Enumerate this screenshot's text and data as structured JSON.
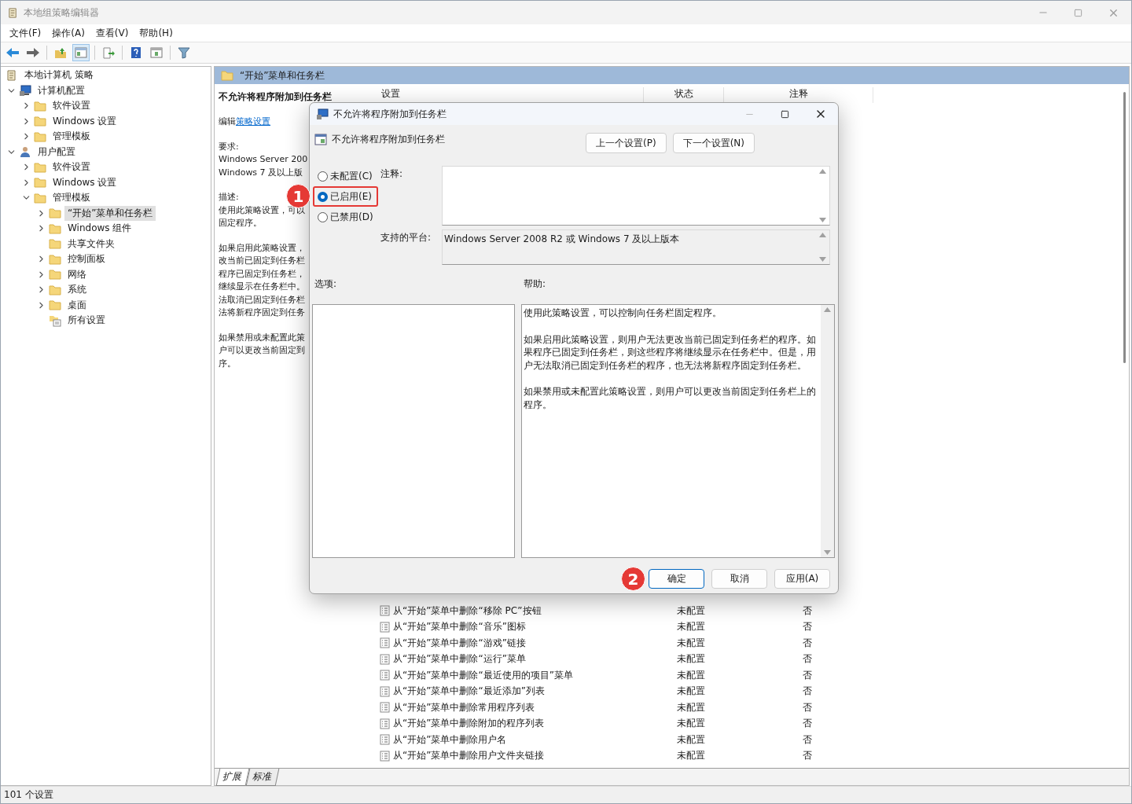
{
  "window": {
    "title": "本地组策略编辑器"
  },
  "menu": [
    "文件(F)",
    "操作(A)",
    "查看(V)",
    "帮助(H)"
  ],
  "toolbar": [
    {
      "kind": "back",
      "pressed": false
    },
    {
      "kind": "forward",
      "pressed": false
    },
    {
      "kind": "up",
      "pressed": false
    },
    {
      "kind": "tree",
      "pressed": true
    },
    {
      "kind": "export",
      "pressed": false
    },
    {
      "kind": "help",
      "pressed": false
    },
    {
      "kind": "view",
      "pressed": false
    },
    {
      "kind": "filter",
      "pressed": false
    }
  ],
  "tree": {
    "label": "本地计算机 策略",
    "kind": "policy",
    "selected": false,
    "children": [
      {
        "label": "计算机配置",
        "kind": "computer",
        "expanded": true,
        "selected": false,
        "children": [
          {
            "label": "软件设置",
            "kind": "folder",
            "expanded": false,
            "selected": false
          },
          {
            "label": "Windows 设置",
            "kind": "folder",
            "expanded": false,
            "selected": false
          },
          {
            "label": "管理模板",
            "kind": "folder",
            "expanded": false,
            "selected": false
          }
        ]
      },
      {
        "label": "用户配置",
        "kind": "user",
        "expanded": true,
        "selected": false,
        "children": [
          {
            "label": "软件设置",
            "kind": "folder",
            "expanded": false,
            "selected": false
          },
          {
            "label": "Windows 设置",
            "kind": "folder",
            "expanded": false,
            "selected": false
          },
          {
            "label": "管理模板",
            "kind": "folder",
            "expanded": true,
            "selected": false,
            "children": [
              {
                "label": "“开始”菜单和任务栏",
                "kind": "folder",
                "expanded": false,
                "selected": true
              },
              {
                "label": "Windows 组件",
                "kind": "folder",
                "expanded": false,
                "selected": false
              },
              {
                "label": "共享文件夹",
                "kind": "folder",
                "selected": false
              },
              {
                "label": "控制面板",
                "kind": "folder",
                "expanded": false,
                "selected": false
              },
              {
                "label": "网络",
                "kind": "folder",
                "expanded": false,
                "selected": false
              },
              {
                "label": "系统",
                "kind": "folder",
                "expanded": false,
                "selected": false
              },
              {
                "label": "桌面",
                "kind": "folder",
                "expanded": false,
                "selected": false
              },
              {
                "label": "所有设置",
                "kind": "settings",
                "selected": false
              }
            ]
          }
        ]
      }
    ]
  },
  "pane": {
    "title": "“开始”菜单和任务栏",
    "description": {
      "heading": "不允许将程序附加到任务栏",
      "edit_prefix": "编辑",
      "edit_link": "策略设置",
      "blocks": [
        [
          "要求:",
          "Windows Server 200",
          "Windows 7 及以上版"
        ],
        [
          "描述:",
          "使用此策略设置，可以",
          "固定程序。"
        ],
        [
          "如果启用此策略设置，",
          "改当前已固定到任务栏",
          "程序已固定到任务栏，",
          "继续显示在任务栏中。",
          "法取消已固定到任务栏",
          "法将新程序固定到任务"
        ],
        [
          "如果禁用或未配置此策",
          "户可以更改当前固定到",
          "序。"
        ]
      ]
    }
  },
  "table": {
    "columns": [
      "设置",
      "状态",
      "注释"
    ],
    "rows": [
      {
        "name": "从“开始”菜单中删除“移除 PC”按钮",
        "state": "未配置",
        "comment": "否"
      },
      {
        "name": "从“开始”菜单中删除“音乐”图标",
        "state": "未配置",
        "comment": "否"
      },
      {
        "name": "从“开始”菜单中删除“游戏”链接",
        "state": "未配置",
        "comment": "否"
      },
      {
        "name": "从“开始”菜单中删除“运行”菜单",
        "state": "未配置",
        "comment": "否"
      },
      {
        "name": "从“开始”菜单中删除“最近使用的项目”菜单",
        "state": "未配置",
        "comment": "否"
      },
      {
        "name": "从“开始”菜单中删除“最近添加”列表",
        "state": "未配置",
        "comment": "否"
      },
      {
        "name": "从“开始”菜单中删除常用程序列表",
        "state": "未配置",
        "comment": "否"
      },
      {
        "name": "从“开始”菜单中删除附加的程序列表",
        "state": "未配置",
        "comment": "否"
      },
      {
        "name": "从“开始”菜单中删除用户名",
        "state": "未配置",
        "comment": "否"
      },
      {
        "name": "从“开始”菜单中删除用户文件夹链接",
        "state": "未配置",
        "comment": "否"
      }
    ]
  },
  "view_tabs": [
    {
      "label": "扩展",
      "selected": true
    },
    {
      "label": "标准",
      "selected": false
    }
  ],
  "status_bar": "101 个设置",
  "dialog": {
    "title": "不允许将程序附加到任务栏",
    "setting_name": "不允许将程序附加到任务栏",
    "nav_buttons": [
      "上一个设置(P)",
      "下一个设置(N)"
    ],
    "options": [
      {
        "label": "未配置(C)",
        "selected": false,
        "highlighted": false
      },
      {
        "label": "已启用(E)",
        "selected": true,
        "highlighted": true,
        "badge": "1"
      },
      {
        "label": "已禁用(D)",
        "selected": false,
        "highlighted": false
      }
    ],
    "comment_label": "注释:",
    "platform_label": "支持的平台:",
    "platform": "Windows Server 2008 R2 或 Windows 7 及以上版本",
    "options_label": "选项:",
    "help_label": "帮助:",
    "help": [
      "使用此策略设置，可以控制向任务栏固定程序。",
      "如果启用此策略设置，则用户无法更改当前已固定到任务栏的程序。如果程序已固定到任务栏，则这些程序将继续显示在任务栏中。但是，用户无法取消已固定到任务栏的程序，也无法将新程序固定到任务栏。",
      "如果禁用或未配置此策略设置，则用户可以更改当前固定到任务栏上的程序。"
    ],
    "buttons": [
      {
        "label": "确定",
        "default": true,
        "badge": "2"
      },
      {
        "label": "取消",
        "default": false
      },
      {
        "label": "应用(A)",
        "default": false
      }
    ]
  }
}
